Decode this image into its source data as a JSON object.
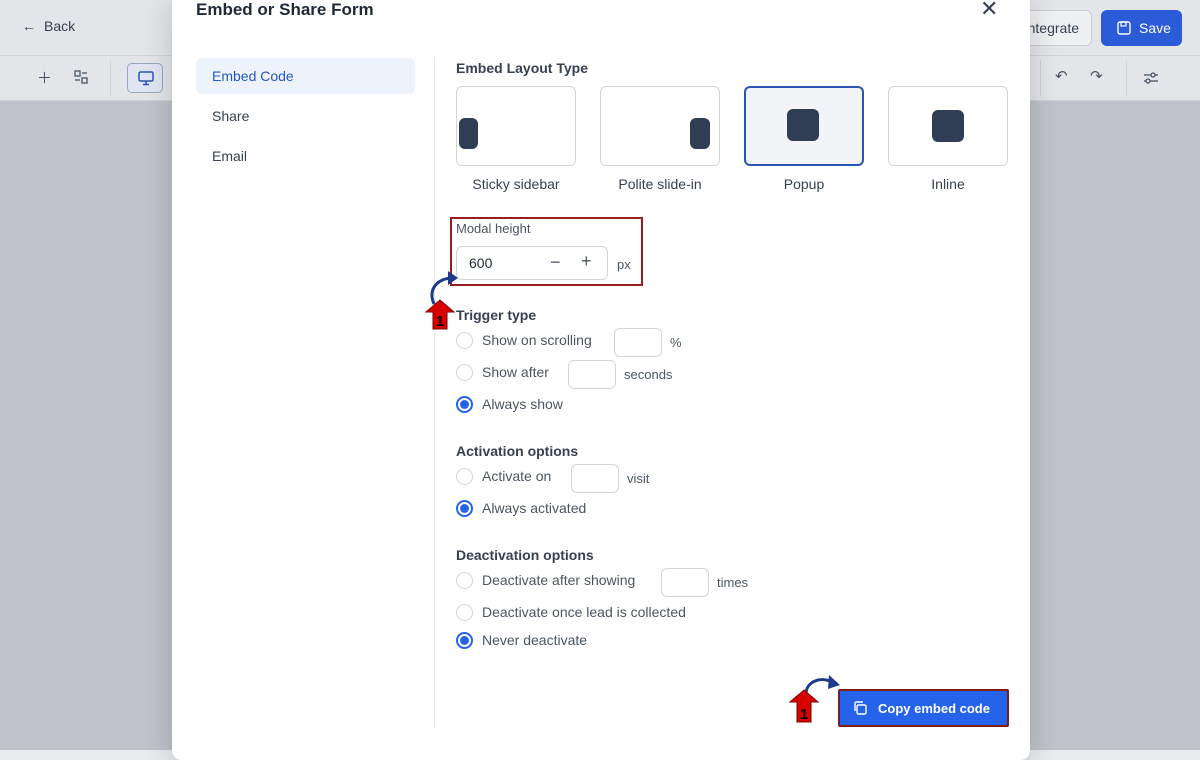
{
  "app": {
    "back_label": "Back",
    "integrate_label": "ntegrate",
    "save_label": "Save"
  },
  "modal": {
    "title": "Embed or Share Form",
    "nav": [
      {
        "label": "Embed Code",
        "active": true
      },
      {
        "label": "Share",
        "active": false
      },
      {
        "label": "Email",
        "active": false
      }
    ],
    "layout_type": {
      "title": "Embed Layout Type",
      "options": [
        {
          "label": "Sticky sidebar",
          "selected": false
        },
        {
          "label": "Polite slide-in",
          "selected": false
        },
        {
          "label": "Popup",
          "selected": true
        },
        {
          "label": "Inline",
          "selected": false
        }
      ]
    },
    "modal_height": {
      "label": "Modal height",
      "value": "600",
      "unit": "px"
    },
    "trigger": {
      "title": "Trigger type",
      "options": [
        {
          "label": "Show on scrolling",
          "suffix": "%",
          "checked": false
        },
        {
          "label": "Show after",
          "suffix": "seconds",
          "checked": false
        },
        {
          "label": "Always show",
          "checked": true
        }
      ]
    },
    "activation": {
      "title": "Activation options",
      "options": [
        {
          "label": "Activate on",
          "suffix": "visit",
          "checked": false
        },
        {
          "label": "Always activated",
          "checked": true
        }
      ]
    },
    "deactivation": {
      "title": "Deactivation options",
      "options": [
        {
          "label": "Deactivate after showing",
          "suffix": "times",
          "checked": false
        },
        {
          "label": "Deactivate once lead is collected",
          "checked": false
        },
        {
          "label": "Never deactivate",
          "checked": true
        }
      ]
    },
    "copy_button_label": "Copy embed code"
  },
  "annotations": {
    "marker_number": "1",
    "highlight_color": "#9b1c1c",
    "arrow_color": "#1e3a8a"
  },
  "colors": {
    "primary": "#2563eb",
    "selected_border": "#2a57b6",
    "block": "#2f3d55"
  }
}
